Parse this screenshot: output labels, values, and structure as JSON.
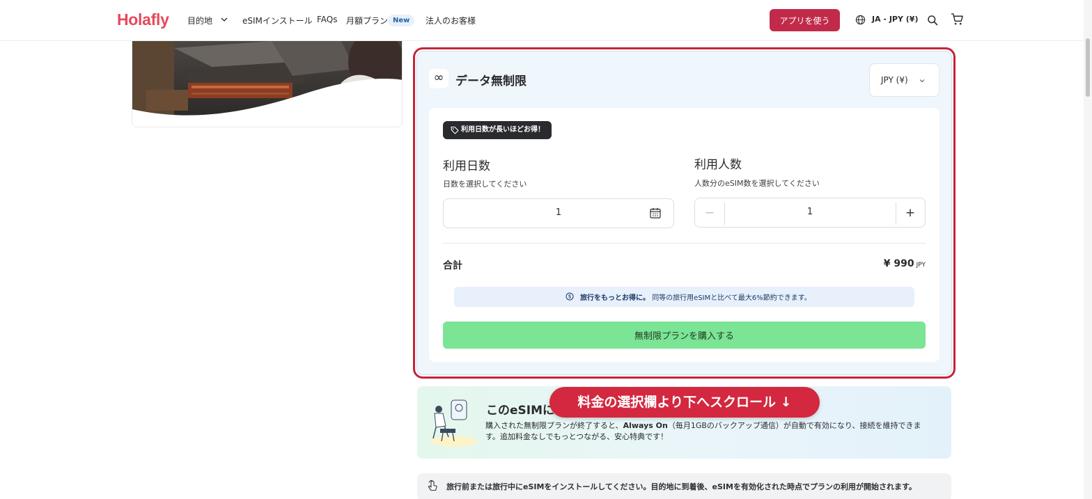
{
  "header": {
    "logo": "Holafly",
    "nav": {
      "destinations": "目的地",
      "esim_install": "eSIMインストール",
      "faqs": "FAQs",
      "monthly_plan": "月額プラン",
      "new_badge": "New",
      "business": "法人のお客様"
    },
    "app_button": "アプリを使う",
    "language": "JA - JPY (¥)"
  },
  "plan": {
    "title": "データ無制限",
    "currency_select": "JPY (¥)",
    "tag": "利用日数が長いほどお得！",
    "days": {
      "title": "利用日数",
      "subtitle": "日数を選択してください",
      "value": "1"
    },
    "people": {
      "title": "利用人数",
      "subtitle": "人数分のeSIM数を選択してください",
      "value": "1",
      "minus": "−",
      "plus": "+"
    },
    "total_label": "合計",
    "total_price": "¥ 990",
    "total_currency": "JPY",
    "save_bold": "旅行をもっとお得に。",
    "save_text": "同等の旅行用eSIMと比べて最大6%節約できます。",
    "buy_button": "無制限プランを購入する"
  },
  "always_on": {
    "title": "このeSIMに",
    "body_pre": "購入された無制限プランが終了すると、",
    "body_bold": "Always On",
    "body_post": "（毎月1GBのバックアップ通信）が自動で有効になり、接続を維持できます。追加料金なしでもっとつながる、安心特典です！"
  },
  "scroll_overlay": "料金の選択欄より下へスクロール ↓",
  "install_note": "旅行前または旅行中にeSIMをインストールしてください。目的地に到着後、eSIMを有効化された時点でプランの利用が開始されます。",
  "colors": {
    "brand": "#E6485C",
    "app_button": "#C22A4A",
    "highlight": "#C7243A",
    "buy_button": "#7BE495",
    "plan_bg": "#EFF6FC"
  }
}
